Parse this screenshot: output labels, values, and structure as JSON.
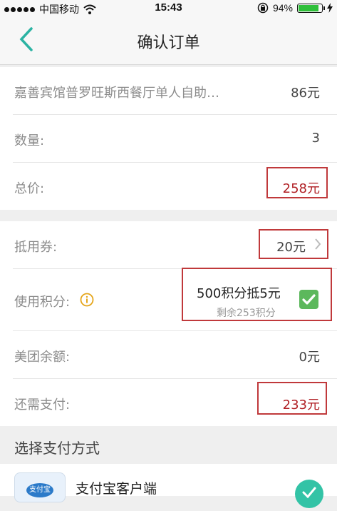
{
  "status_bar": {
    "carrier": "中国移动",
    "time": "15:43",
    "battery_percent_text": "94%",
    "battery_level": 0.94
  },
  "nav": {
    "title": "确认订单"
  },
  "order": {
    "item_name": "嘉善宾馆普罗旺斯西餐厅单人自助…",
    "item_price": "86元",
    "quantity_label": "数量:",
    "quantity_value": "3",
    "total_label": "总价:",
    "total_value": "258元"
  },
  "discounts": {
    "coupon_label": "抵用券:",
    "coupon_value": "20元",
    "points_label": "使用积分:",
    "points_offer": "500积分抵5元",
    "points_remaining": "剩余253积分",
    "points_checked": true,
    "balance_label": "美团余额:",
    "balance_value": "0元",
    "due_label": "还需支付:",
    "due_value": "233元"
  },
  "payment": {
    "section_title": "选择支付方式",
    "method_name": "支付宝客户端",
    "logo_text": "支付宝"
  },
  "colors": {
    "accent": "#2bb3a3",
    "highlight_red": "#b01f24",
    "annotation_box": "#c0393b",
    "checkbox_green": "#5cb85c"
  }
}
